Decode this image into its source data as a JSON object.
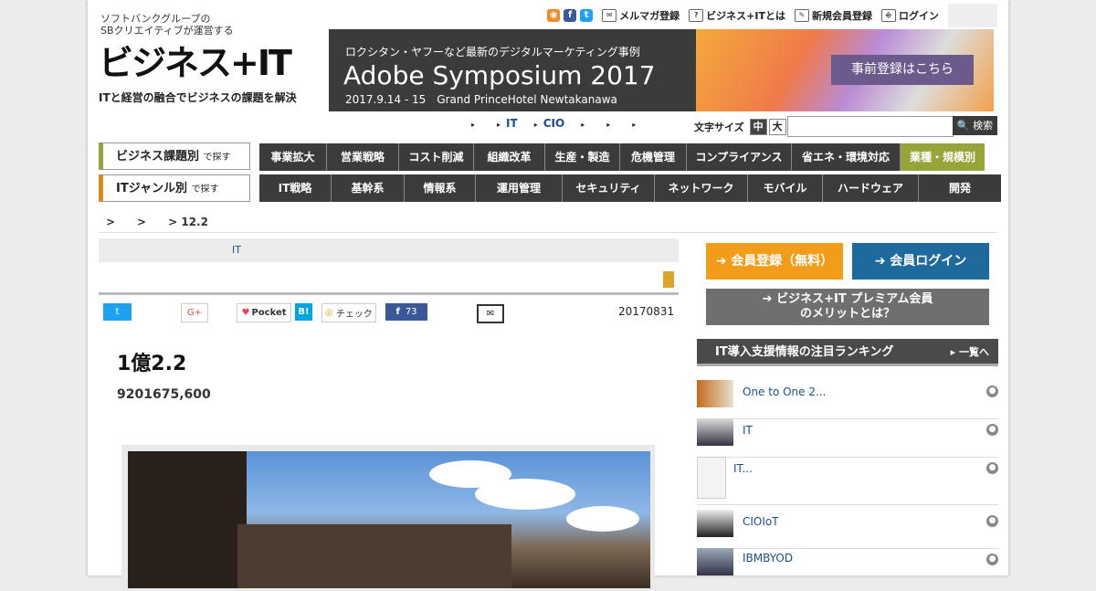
{
  "header": {
    "tagline_top": "ソフトバンクグループの",
    "tagline_top2": "SBクリエイティブが運営する",
    "logo": "ビジネス+IT",
    "tagline": "ITと経営の融合でビジネスの課題を解決",
    "toplinks": {
      "mailmag": "メルマガ登録",
      "about": "ビジネス+ITとは",
      "register": "新規会員登録",
      "login": "ログイン"
    }
  },
  "banner": {
    "subtitle": "ロクシタン・ヤフーなど最新のデジタルマーケティング事例",
    "title": "Adobe Symposium 2017",
    "date": "2017.9.14 - 15　Grand PrinceHotel Newtakanawa",
    "cta": "事前登録はこちら"
  },
  "subnav": [
    "IT",
    "CIO"
  ],
  "fontsize": {
    "label": "文字サイズ",
    "mid": "中",
    "large": "大"
  },
  "search": {
    "button": "検索"
  },
  "nav1": {
    "label": "ビジネス課題別",
    "label_small": "で探す",
    "items": [
      "事業拡大",
      "営業戦略",
      "コスト削減",
      "組織改革",
      "生産・製造",
      "危機管理",
      "コンプライアンス",
      "省エネ・環境対応",
      "業種・規模別"
    ]
  },
  "nav2": {
    "label": "ITジャンル別",
    "label_small": "で探す",
    "items": [
      "IT戦略",
      "基幹系",
      "情報系",
      "運用管理",
      "セキュリティ",
      "ネットワーク",
      "モバイル",
      "ハードウェア",
      "開発"
    ]
  },
  "breadcrumb": ">　　>　　> 12.2",
  "article": {
    "category": "IT",
    "date": "20170831",
    "share": {
      "pocket": "Pocket",
      "hatena": "B!",
      "check": "チェック",
      "fb_count": "73"
    },
    "title": "1億2.2",
    "lead": "9201675,600",
    "author": "　　　"
  },
  "sidebar": {
    "register": "会員登録（無料）",
    "login": "会員ログイン",
    "premium_line1": "ビジネス+IT プレミアム会員",
    "premium_line2": "のメリットとは？",
    "ranking_title": "IT導入支援情報の注目ランキング",
    "ranking_more": "一覧へ",
    "ranking": [
      "One to One 2...",
      "IT",
      "IT...",
      "CIOIoT",
      "IBMBYOD"
    ]
  },
  "colors": {
    "orange": "#f39c1a",
    "blue": "#1e6a9c",
    "green": "#98a33a",
    "dark": "#3b3b3b"
  }
}
